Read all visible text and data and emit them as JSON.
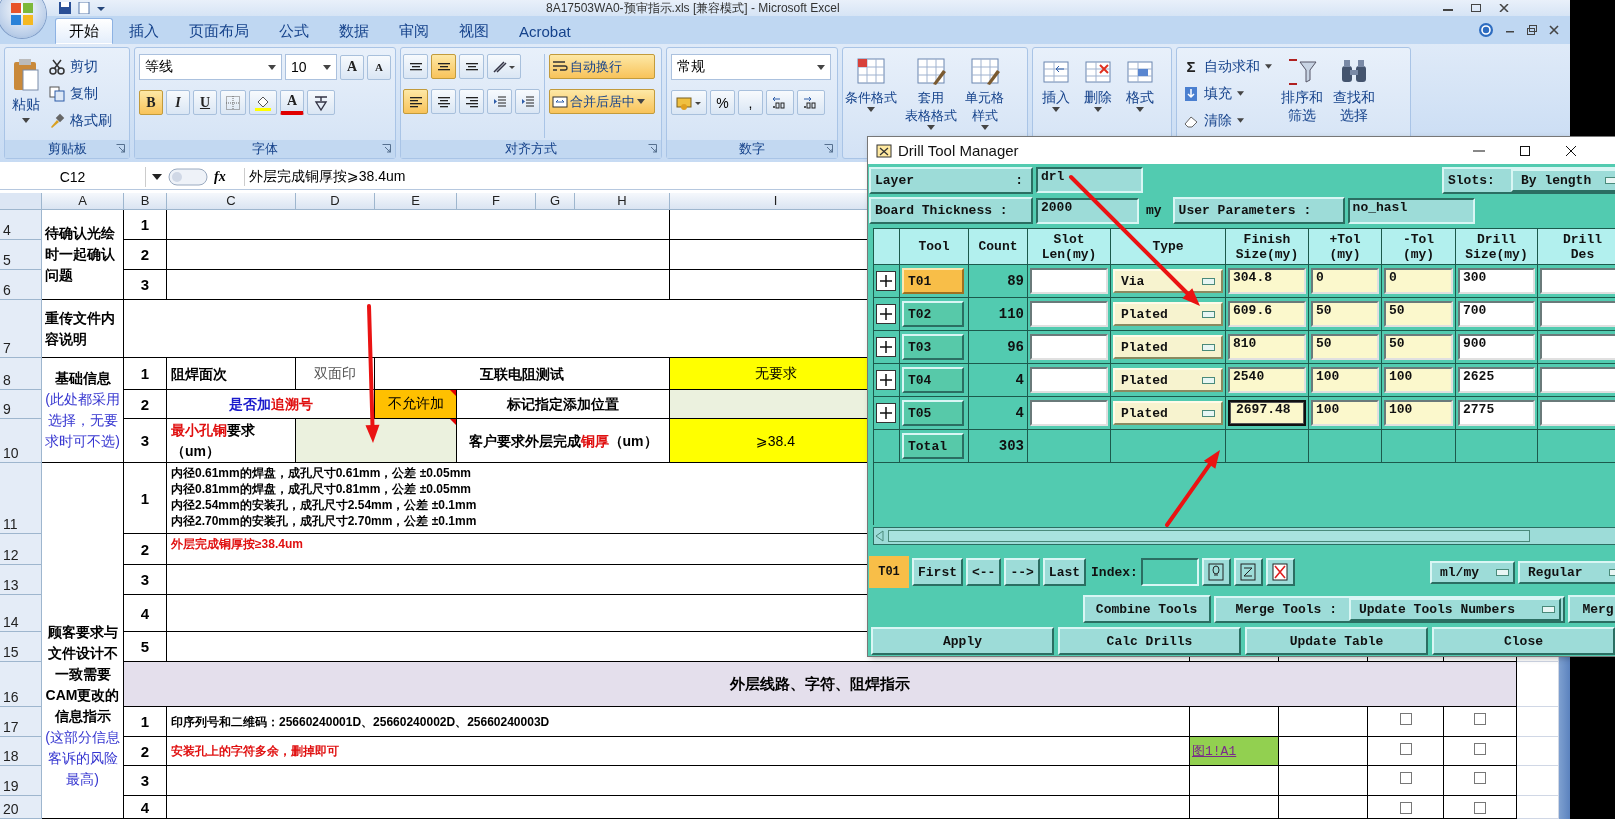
{
  "window": {
    "title": "8A17503WA0-预审指示.xls  [兼容模式] - Microsoft Excel"
  },
  "ribbon_tabs": [
    {
      "label": "开始",
      "selected": true
    },
    {
      "label": "插入",
      "selected": false
    },
    {
      "label": "页面布局",
      "selected": false
    },
    {
      "label": "公式",
      "selected": false
    },
    {
      "label": "数据",
      "selected": false
    },
    {
      "label": "审阅",
      "selected": false
    },
    {
      "label": "视图",
      "selected": false
    },
    {
      "label": "Acrobat",
      "selected": false
    }
  ],
  "clipboard": {
    "label": "剪贴板",
    "paste": "粘贴",
    "items": [
      "剪切",
      "复制",
      "格式刷"
    ]
  },
  "font": {
    "label": "字体",
    "family": "等线",
    "size": "10",
    "grow": "A",
    "shrink": "A",
    "styles": [
      {
        "label": "B",
        "on": true
      },
      {
        "label": "I",
        "on": false
      },
      {
        "label": "U",
        "on": false
      }
    ],
    "color_letter": "A"
  },
  "alignment": {
    "label": "对齐方式",
    "vertical": [
      {
        "selected": false
      },
      {
        "selected": true
      },
      {
        "selected": false
      }
    ],
    "horizontal": [
      {
        "selected": true
      },
      {
        "selected": false
      },
      {
        "selected": false
      }
    ],
    "wrap": {
      "label": "自动换行",
      "on": true
    },
    "merge": {
      "label": "合并后居中",
      "on": true
    }
  },
  "number": {
    "label": "数字",
    "format": "常规",
    "percent": "%",
    "comma": ","
  },
  "styles": [
    {
      "lines": [
        "条件格式"
      ]
    },
    {
      "lines": [
        "套用",
        "表格格式"
      ]
    },
    {
      "lines": [
        "单元格",
        "样式"
      ]
    }
  ],
  "cells": [
    {
      "label": "插入"
    },
    {
      "label": "删除"
    },
    {
      "label": "格式"
    }
  ],
  "editing": {
    "sigma": "Σ",
    "items": [
      "自动求和",
      "填充",
      "清除"
    ],
    "buttons": [
      {
        "lines": [
          "排序和",
          "筛选"
        ]
      },
      {
        "lines": [
          "查找和",
          "选择"
        ]
      }
    ]
  },
  "formula_bar": {
    "name_box": "C12",
    "fx": "fx",
    "formula": "外层完成铜厚按⩾38.4um"
  },
  "column_headers": [
    "A",
    "B",
    "C",
    "D",
    "E",
    "F",
    "G",
    "H",
    "I"
  ],
  "row_headers": [
    "4",
    "5",
    "6",
    "7",
    "8",
    "9",
    "10",
    "11",
    "12",
    "13",
    "14",
    "15",
    "16",
    "17",
    "18",
    "19",
    "20"
  ],
  "pending": {
    "title": "待确认光绘时一起确认问题",
    "numbers": [
      "1",
      "2",
      "3"
    ]
  },
  "reupload": {
    "title": "重传文件内容说明"
  },
  "basic": {
    "title": "基础信息",
    "note": "(此处都采用选择，无要求时可不选)",
    "rows": [
      {
        "no": "1",
        "label": [
          {
            "text": "阻焊面次",
            "color": "#000000"
          }
        ],
        "value": {
          "text": "双面印",
          "comment": false
        },
        "label2": [
          {
            "text": "互联电阻测试",
            "color": "#000000"
          }
        ],
        "value2": {
          "text": "无要求",
          "color": "#ffff00"
        }
      },
      {
        "no": "2",
        "label": [
          {
            "text": "是否加",
            "color": "#1a1acc"
          },
          {
            "text": "追溯号",
            "color": "#e01010"
          }
        ],
        "value": {
          "text": "不允许加",
          "color": "#ffc000",
          "comment": true
        },
        "label2": [
          {
            "text": "标记指定添加位置",
            "color": "#000000"
          }
        ],
        "value2": {
          "color": "#ebf1de"
        }
      },
      {
        "no": "3",
        "label": [
          {
            "text": "最小孔铜",
            "color": "#e01010"
          },
          {
            "text": "要求",
            "color": "#000000"
          },
          {
            "text": "（um）",
            "color": "#000000"
          }
        ],
        "value": {
          "color": "#ebf1de",
          "comment": true
        },
        "label2": [
          {
            "text": "客户要求外层完成",
            "color": "#000000"
          },
          {
            "text": "铜厚",
            "color": "#e01010"
          },
          {
            "text": "（um）",
            "color": "#000000"
          }
        ],
        "value2": {
          "text": "⩾38.4",
          "color": "#ffff00"
        }
      }
    ]
  },
  "changes": {
    "title": "顾客要求与文件设计不一致需要CAM更改的信息指示",
    "note": "(这部分信息客诉的风险最高)",
    "items": [
      {
        "no": "1",
        "alert": false,
        "lines": [
          "内径0.61mm的焊盘，成孔尺寸0.61mm，公差 ±0.05mm",
          "内径0.81mm的焊盘，成孔尺寸0.81mm，公差 ±0.05mm",
          "内径2.54mm的安装孔，成孔尺寸2.54mm，公差 ±0.1mm",
          "内径2.70mm的安装孔，成孔尺寸2.70mm，公差 ±0.1mm"
        ]
      },
      {
        "no": "2",
        "alert": true,
        "lines": [
          "外层完成铜厚按≥38.4um"
        ]
      },
      {
        "no": "3"
      },
      {
        "no": "4"
      },
      {
        "no": "5"
      }
    ]
  },
  "band": {
    "title": "外层线路、字符、阻焊指示"
  },
  "instructions": [
    {
      "no": "1",
      "text": "印序列号和二维码：25660240001D、25660240002D、25660240003D",
      "alert": false,
      "checks": [
        {
          "checked": false
        },
        {
          "checked": false
        }
      ]
    },
    {
      "no": "2",
      "text": "安装孔上的字符多余，删掉即可",
      "alert": true,
      "link": "图1!A1",
      "checks": [
        {
          "checked": false
        },
        {
          "checked": false
        }
      ]
    },
    {
      "no": "3",
      "checks": [
        {
          "checked": false
        },
        {
          "checked": false
        }
      ]
    },
    {
      "no": "4",
      "checks": [
        {
          "checked": false
        },
        {
          "checked": false
        }
      ]
    }
  ],
  "dialog": {
    "title": "Drill Tool Manager",
    "layer": {
      "label": "Layer",
      "colon": ":",
      "value": "drl"
    },
    "slots": {
      "label": "Slots:",
      "value": "By length"
    },
    "thickness": {
      "label": "Board Thickness :",
      "value": "2000",
      "unit": "my"
    },
    "user_params": {
      "label": "User Parameters :",
      "value": "no_hasl"
    },
    "columns": [
      {
        "lines": [
          "Tool"
        ]
      },
      {
        "lines": [
          "Count"
        ]
      },
      {
        "lines": [
          "Slot",
          "Len(my)"
        ]
      },
      {
        "lines": [
          "Type"
        ]
      },
      {
        "lines": [
          "Finish",
          "Size(my)"
        ]
      },
      {
        "lines": [
          "+Tol",
          "(my)"
        ]
      },
      {
        "lines": [
          "-Tol",
          "(my)"
        ]
      },
      {
        "lines": [
          "Drill",
          "Size(my)"
        ]
      },
      {
        "lines": [
          "Drill",
          "Des"
        ]
      }
    ],
    "tools": [
      {
        "tool": "T01",
        "selected": true,
        "count": "89",
        "type": "Via",
        "finish": "304.8",
        "focused": false,
        "plus_tol": "0",
        "minus_tol": "0",
        "drill": "300"
      },
      {
        "tool": "T02",
        "selected": false,
        "count": "110",
        "type": "Plated",
        "finish": "609.6",
        "focused": false,
        "plus_tol": "50",
        "minus_tol": "50",
        "drill": "700"
      },
      {
        "tool": "T03",
        "selected": false,
        "count": "96",
        "type": "Plated",
        "finish": "810",
        "focused": false,
        "plus_tol": "50",
        "minus_tol": "50",
        "drill": "900"
      },
      {
        "tool": "T04",
        "selected": false,
        "count": "4",
        "type": "Plated",
        "finish": "2540",
        "focused": false,
        "plus_tol": "100",
        "minus_tol": "100",
        "drill": "2625"
      },
      {
        "tool": "T05",
        "selected": false,
        "count": "4",
        "type": "Plated",
        "finish": "2697.48",
        "focused": true,
        "plus_tol": "100",
        "minus_tol": "100",
        "drill": "2775"
      }
    ],
    "total": {
      "label": "Total",
      "count": "303"
    },
    "nav": {
      "current": "T01",
      "buttons": [
        "First",
        "<--",
        "-->",
        "Last"
      ],
      "index_label": "Index:",
      "units": "ml/my",
      "mode": "Regular"
    },
    "merge_row": {
      "combine": "Combine Tools",
      "merge_label": "Merge Tools :",
      "merge_mode": "Update Tools Numbers",
      "cut_button": "Merg"
    },
    "bottom_buttons": [
      "Apply",
      "Calc Drills",
      "Update Table",
      "Close"
    ]
  }
}
